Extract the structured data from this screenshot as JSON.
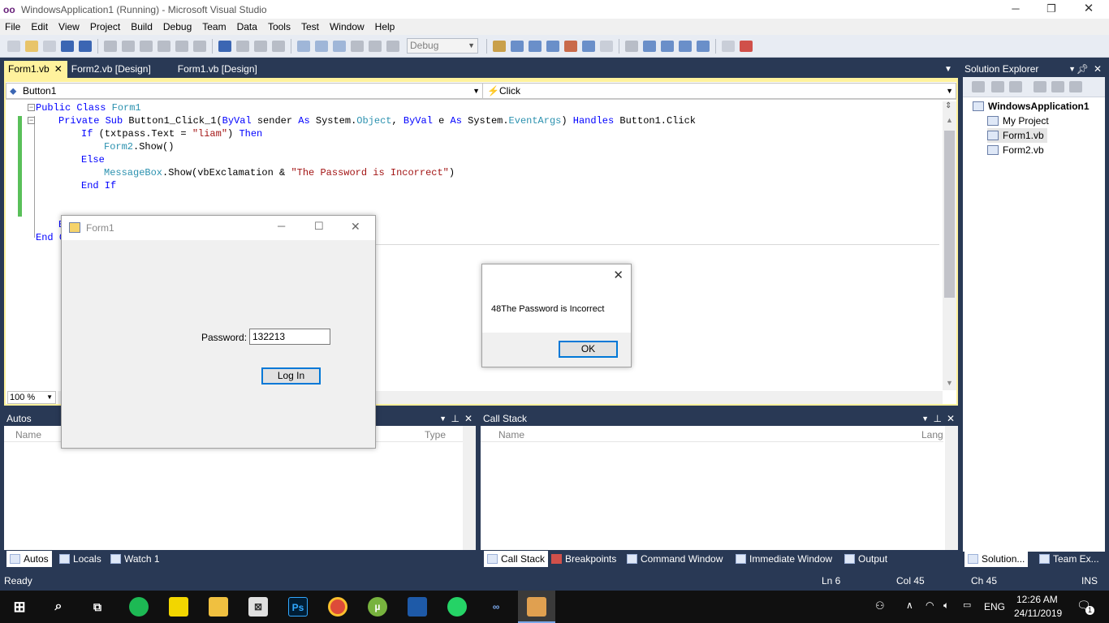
{
  "window": {
    "title": "WindowsApplication1 (Running) - Microsoft Visual Studio",
    "logo": "oo"
  },
  "menu": [
    "File",
    "Edit",
    "View",
    "Project",
    "Build",
    "Debug",
    "Team",
    "Data",
    "Tools",
    "Test",
    "Window",
    "Help"
  ],
  "toolbar": {
    "config": "Debug"
  },
  "doc_tabs": [
    {
      "label": "Form1.vb",
      "active": true
    },
    {
      "label": "Form2.vb [Design]",
      "active": false
    },
    {
      "label": "Form1.vb [Design]",
      "active": false
    }
  ],
  "editor": {
    "object_dropdown": "Button1",
    "event_dropdown": "Click",
    "zoom": "100 %",
    "code": {
      "l1_kw": "Public Class ",
      "l1_name": "Form1",
      "l2_a": "Private Sub ",
      "l2_b": "Button1_Click_1(",
      "l2_c": "ByVal",
      "l2_d": " sender ",
      "l2_e": "As",
      "l2_f": " System.",
      "l2_g": "Object",
      "l2_h": ", ",
      "l2_i": "ByVal",
      "l2_j": " e ",
      "l2_k": "As",
      "l2_l": " System.",
      "l2_m": "EventArgs",
      "l2_n": ") ",
      "l2_o": "Handles",
      "l2_p": " Button1.Click",
      "l3_a": "If",
      "l3_b": " (txtpass.Text = ",
      "l3_c": "\"liam\"",
      "l3_d": ") ",
      "l3_e": "Then",
      "l4_a": "Form2",
      "l4_b": ".Show()",
      "l5": "Else",
      "l6_a": "MessageBox",
      "l6_b": ".Show(vbExclamation & ",
      "l6_c": "\"The Password is Incorrect\"",
      "l6_d": ")",
      "l7": "End If",
      "l8": "E",
      "l9_a": "End ",
      "l9_b": "C"
    }
  },
  "solution_explorer": {
    "title": "Solution Explorer",
    "solution": "WindowsApplication1",
    "items": [
      "My Project",
      "Form1.vb",
      "Form2.vb"
    ]
  },
  "autos": {
    "title": "Autos",
    "col_name": "Name",
    "col_type": "Type"
  },
  "callstack": {
    "title": "Call Stack",
    "col_name": "Name",
    "col_lang": "Lang"
  },
  "bottom_tabs_left": [
    "Autos",
    "Locals",
    "Watch 1"
  ],
  "bottom_tabs_right": [
    "Call Stack",
    "Breakpoints",
    "Command Window",
    "Immediate Window",
    "Output"
  ],
  "side_tabs": [
    "Solution...",
    "Team Ex..."
  ],
  "status": {
    "ready": "Ready",
    "ln": "Ln 6",
    "col": "Col 45",
    "ch": "Ch 45",
    "ins": "INS"
  },
  "form1": {
    "title": "Form1",
    "password_label": "Password:",
    "password_value": "132213",
    "login_label": "Log In"
  },
  "msgbox": {
    "text": "48The Password is Incorrect",
    "ok": "OK"
  },
  "taskbar": {
    "lang": "ENG",
    "time": "12:26 AM",
    "date": "24/11/2019",
    "notif_count": "1"
  }
}
